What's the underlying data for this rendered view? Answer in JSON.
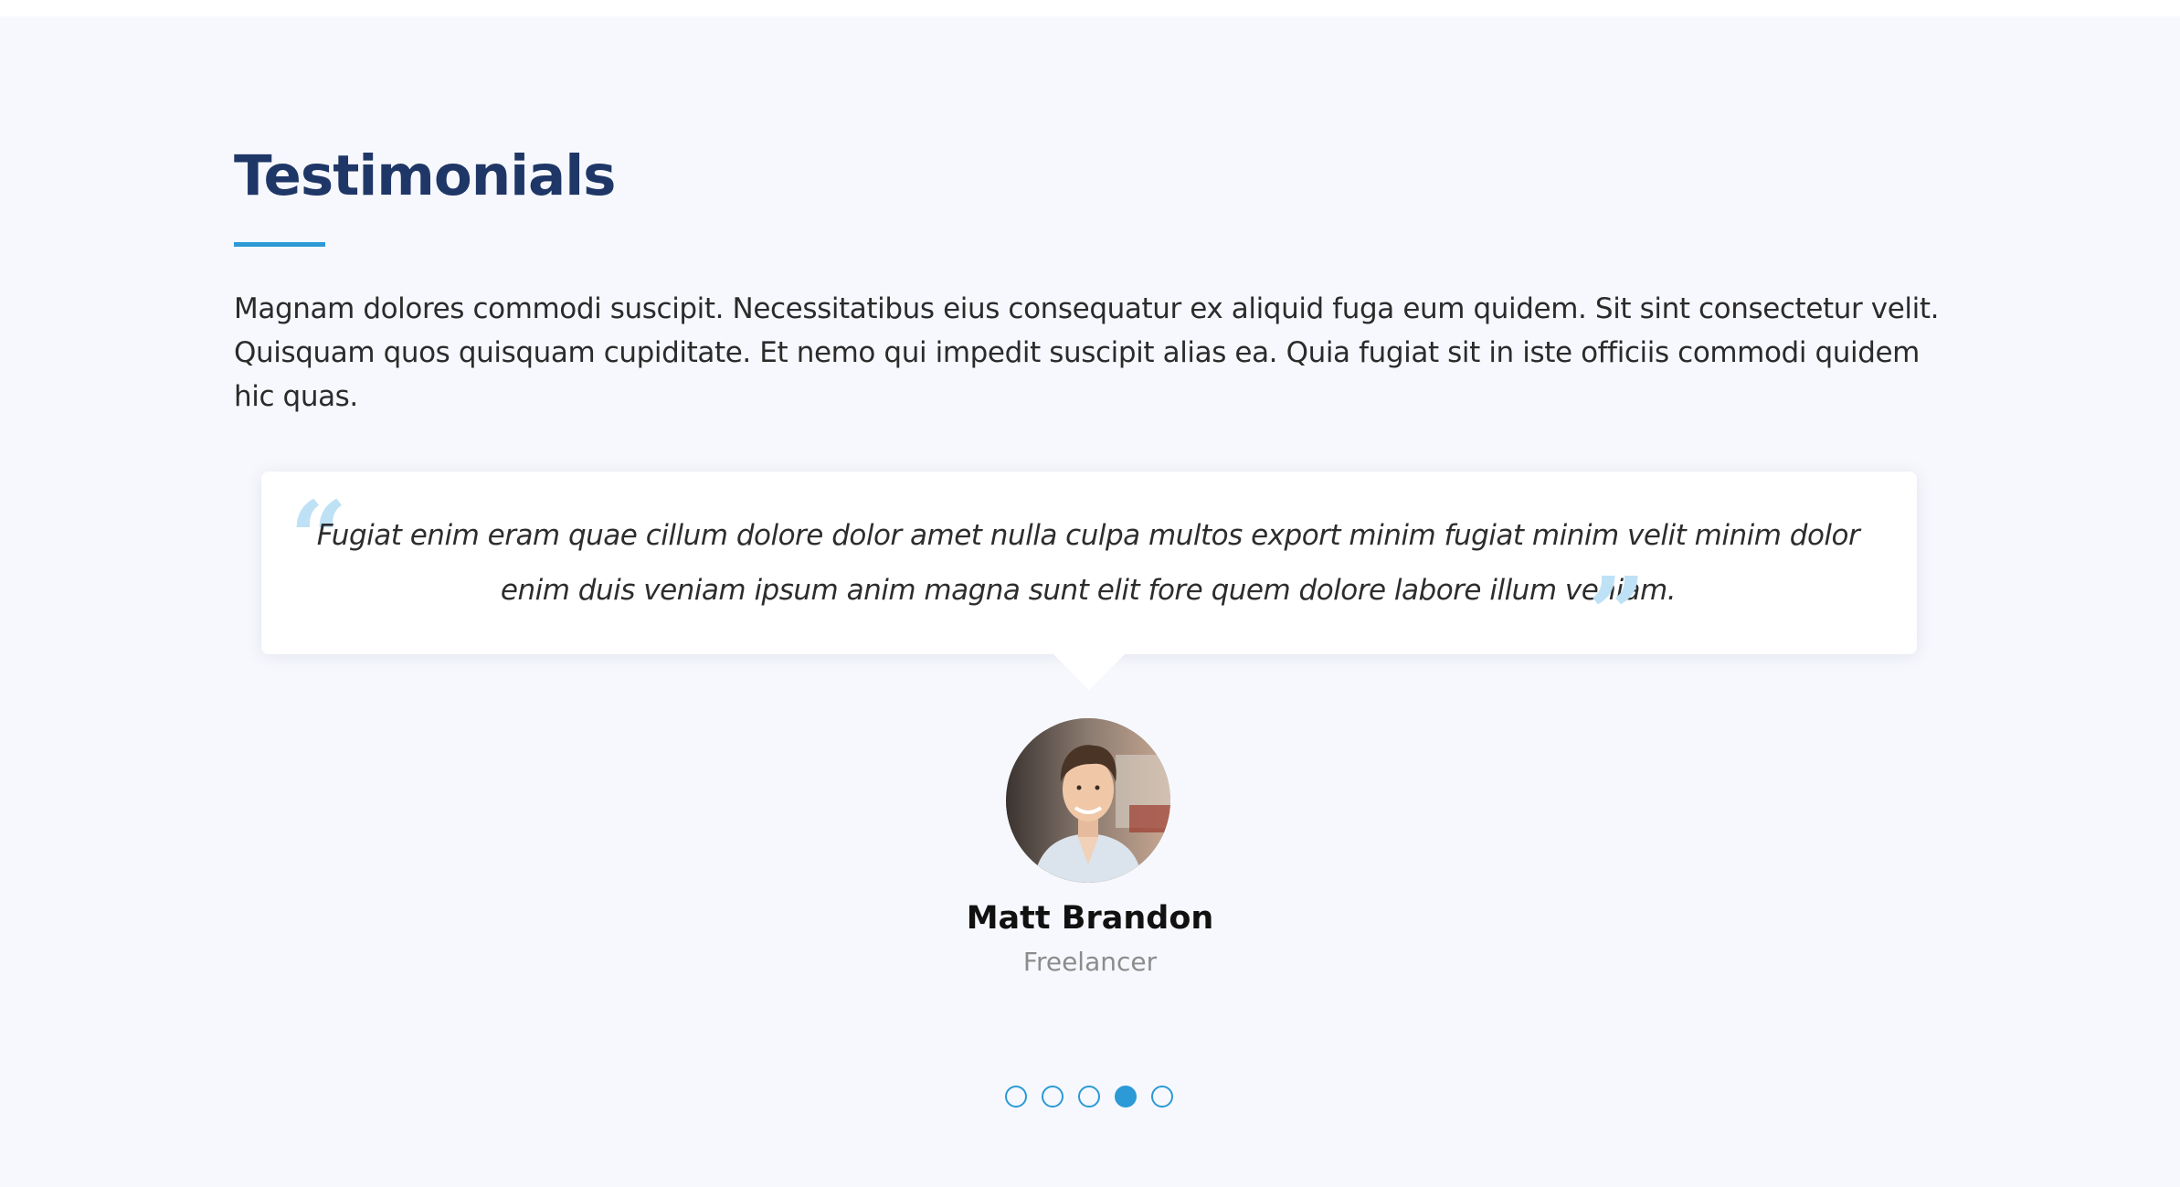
{
  "section": {
    "title": "Testimonials",
    "description": "Magnam dolores commodi suscipit. Necessitatibus eius consequatur ex aliquid fuga eum quidem. Sit sint consectetur velit. Quisquam quos quisquam cupiditate. Et nemo qui impedit suscipit alias ea. Quia fugiat sit in iste officiis commodi quidem hic quas."
  },
  "testimonial": {
    "quote": "Fugiat enim eram quae cillum dolore dolor amet nulla culpa multos export minim fugiat minim velit minim dolor enim duis veniam ipsum anim magna sunt elit fore quem dolore labore illum veniam.",
    "open_quote_icon": "quote-left-icon",
    "close_quote_icon": "quote-right-icon",
    "name": "Matt Brandon",
    "role": "Freelancer"
  },
  "pagination": {
    "count": 5,
    "active_index": 3
  },
  "colors": {
    "title": "#1f3767",
    "accent": "#2b9ad6",
    "quote_icon": "#bfe1f6",
    "background": "#f7f8fd"
  }
}
